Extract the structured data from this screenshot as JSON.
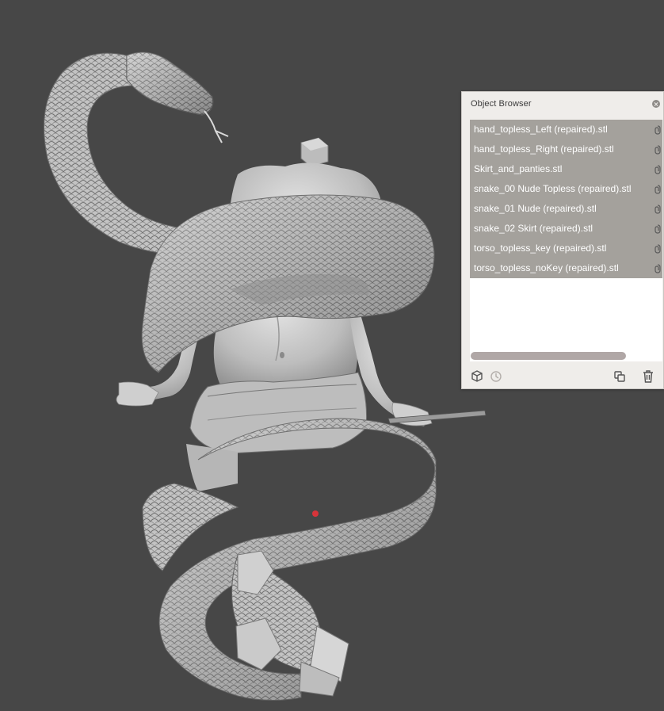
{
  "viewport": {
    "background_color": "#474747",
    "model_color": "#c8c8c8",
    "marker_color": "#d8343a"
  },
  "object_browser": {
    "title": "Object Browser",
    "items": [
      {
        "label": "hand_topless_Left (repaired).stl",
        "icon": "link-icon"
      },
      {
        "label": "hand_topless_Right (repaired).stl",
        "icon": "link-icon"
      },
      {
        "label": "Skirt_and_panties.stl",
        "icon": "link-icon"
      },
      {
        "label": "snake_00 Nude Topless (repaired).stl",
        "icon": "link-icon"
      },
      {
        "label": "snake_01 Nude (repaired).stl",
        "icon": "link-icon"
      },
      {
        "label": "snake_02 Skirt (repaired).stl",
        "icon": "link-icon"
      },
      {
        "label": "torso_topless_key (repaired).stl",
        "icon": "link-icon"
      },
      {
        "label": "torso_topless_noKey (repaired).stl",
        "icon": "link-icon"
      }
    ],
    "selected_color": "#a4a19c",
    "toolbar": {
      "left": [
        "cube-icon",
        "clock-icon"
      ],
      "right": [
        "duplicate-icon",
        "trash-icon"
      ]
    }
  }
}
